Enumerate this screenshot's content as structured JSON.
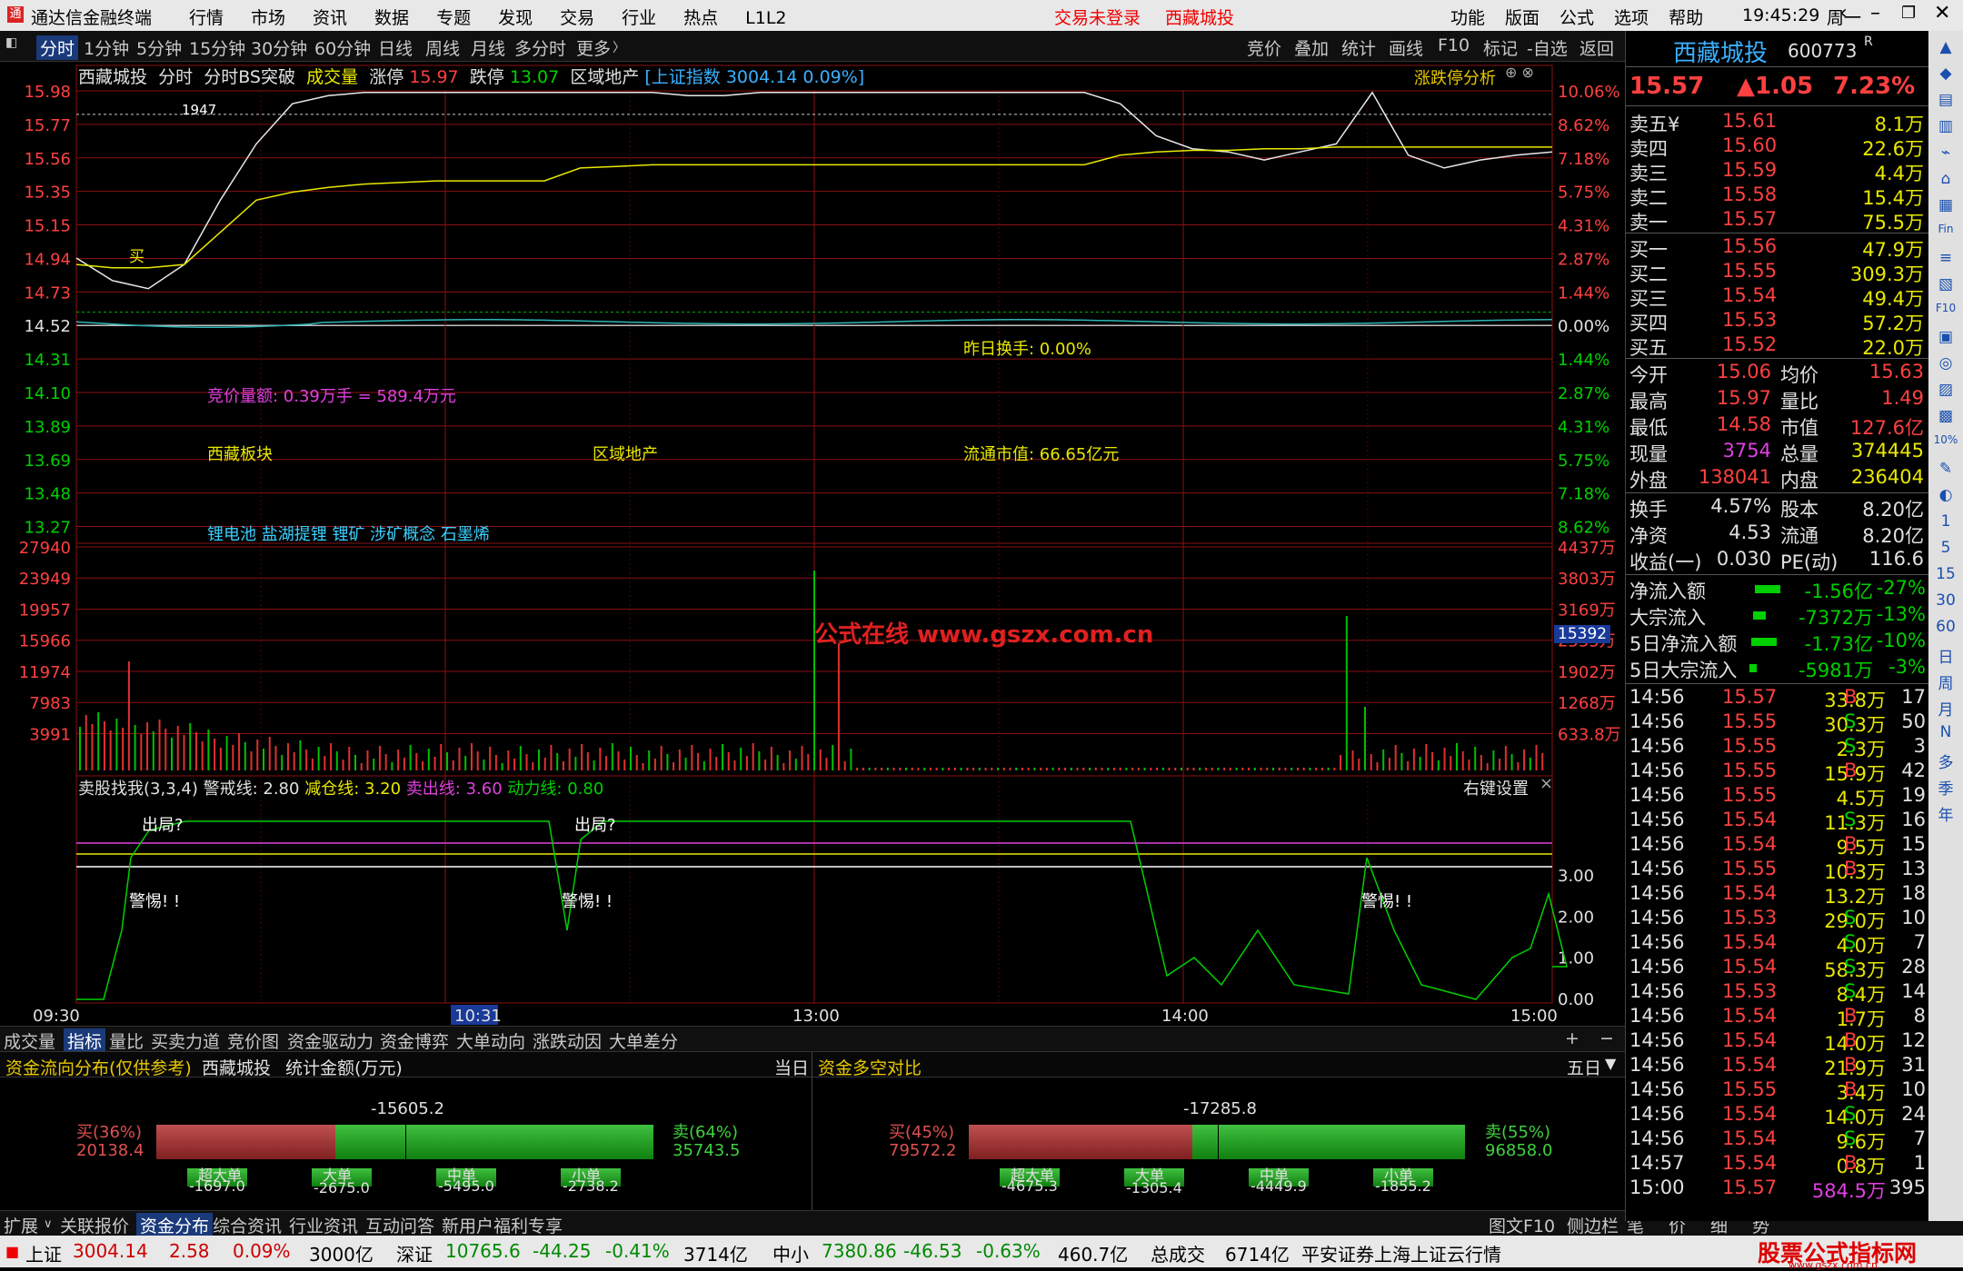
{
  "app": {
    "title": "通达信金融终端",
    "menu": [
      "行情",
      "市场",
      "资讯",
      "数据",
      "专题",
      "发现",
      "交易",
      "行业",
      "热点",
      "L1L2"
    ],
    "login_status": "交易未登录",
    "current_stock": "西藏城投",
    "right_menu": [
      "功能",
      "版面",
      "公式",
      "选项",
      "帮助"
    ],
    "clock": "19:45:29",
    "weekday": "周一"
  },
  "toolbar": {
    "periods": [
      "分时",
      "1分钟",
      "5分钟",
      "15分钟",
      "30分钟",
      "60分钟",
      "日线",
      "周线",
      "月线",
      "多分时",
      "更多"
    ],
    "right_buttons": [
      "竞价",
      "叠加",
      "统计",
      "画线",
      "F10",
      "标记",
      "-自选",
      "返回"
    ]
  },
  "chart_header": {
    "stock": "西藏城投",
    "mode": "分时",
    "formula": "分时BS突破",
    "vol_label": "成交量",
    "limit_up_label": "涨停",
    "limit_up": "15.97",
    "limit_down_label": "跌停",
    "limit_down": "13.07",
    "sector": "区域地产",
    "index_info": "[上证指数 3004.14 0.09%]",
    "analysis_btn": "涨跌停分析"
  },
  "price_axis": {
    "left": [
      "15.98",
      "15.77",
      "15.56",
      "15.35",
      "15.15",
      "14.94",
      "14.73",
      "14.52",
      "14.31",
      "14.10",
      "13.89",
      "13.69",
      "13.48",
      "13.27"
    ],
    "right": [
      "10.06%",
      "8.62%",
      "7.18%",
      "5.75%",
      "4.31%",
      "2.87%",
      "1.44%",
      "0.00%",
      "1.44%",
      "2.87%",
      "4.31%",
      "5.75%",
      "7.18%",
      "8.62%"
    ],
    "prev_close": "14.52"
  },
  "chart_data": {
    "type": "line",
    "x_ticks": [
      "09:30",
      "10:31",
      "13:00",
      "14:00",
      "15:00"
    ],
    "series": [
      {
        "name": "价格",
        "values": [
          14.94,
          14.8,
          14.75,
          14.9,
          15.3,
          15.65,
          15.9,
          15.95,
          15.97,
          15.97,
          15.97,
          15.97,
          15.97,
          15.97,
          15.97,
          15.97,
          15.97,
          15.95,
          15.95,
          15.97,
          15.97,
          15.97,
          15.97,
          15.97,
          15.97,
          15.97,
          15.97,
          15.97,
          15.97,
          15.9,
          15.7,
          15.62,
          15.6,
          15.55,
          15.6,
          15.65,
          15.97,
          15.58,
          15.5,
          15.55,
          15.58,
          15.6
        ]
      },
      {
        "name": "均价",
        "values": [
          14.9,
          14.88,
          14.88,
          14.9,
          15.1,
          15.3,
          15.35,
          15.38,
          15.4,
          15.41,
          15.42,
          15.42,
          15.42,
          15.42,
          15.5,
          15.51,
          15.52,
          15.52,
          15.52,
          15.52,
          15.52,
          15.52,
          15.52,
          15.52,
          15.52,
          15.52,
          15.52,
          15.52,
          15.52,
          15.58,
          15.6,
          15.61,
          15.61,
          15.62,
          15.62,
          15.63,
          15.63,
          15.63,
          15.63,
          15.63,
          15.63,
          15.63
        ]
      }
    ]
  },
  "annotations": {
    "high_tag": "1947",
    "buy_mark": "买",
    "turnover_yday": "昨日换手: 0.00%",
    "auction_amount": "竞价量额: 0.39万手 = 589.4万元",
    "region": "西藏板块",
    "sector2": "区域地产",
    "float_cap": "流通市值: 66.65亿元",
    "concepts": "锂电池 盐湖提锂 锂矿 涉矿概念 石墨烯",
    "watermark": "公式在线  www.gszx.com.cn"
  },
  "volume_axis": {
    "left": [
      "27940",
      "23949",
      "19957",
      "15966",
      "11974",
      "7983",
      "3991"
    ],
    "right": [
      "4437万",
      "3803万",
      "3169万",
      "2535万",
      "1902万",
      "1268万",
      "633.8万"
    ],
    "current": "15392"
  },
  "indicator": {
    "name": "卖股找我(3,3,4)",
    "alert_line": "警戒线: 2.80",
    "reduce_line": "减仓线: 3.20",
    "sell_line": "卖出线: 3.60",
    "power_line": "动力线: 0.80",
    "right_btn": "右键设置",
    "close": "×",
    "axis": [
      "3.00",
      "2.00",
      "1.00",
      "0.00"
    ],
    "labels": [
      "出局?",
      "出局?",
      "警惕! !",
      "警惕! !",
      "警惕! !"
    ]
  },
  "time_axis": [
    "09:30",
    "10:31",
    "13:00",
    "14:00",
    "15:00"
  ],
  "bottom_tabs": [
    "成交量",
    "指标",
    "量比",
    "买卖力道",
    "竞价图",
    "资金驱动力",
    "资金博弈",
    "大单动向",
    "涨跌动因",
    "大单差分"
  ],
  "flow": {
    "left_title": "资金流向分布(仅供参考)",
    "left_stock": "西藏城投",
    "left_unit": "统计金额(万元)",
    "left_period": "当日",
    "left_net": "-15605.2",
    "left_buy_pct": "买(36%)",
    "left_buy": "20138.4",
    "left_sell_pct": "卖(64%)",
    "left_sell": "35743.5",
    "left_cats": [
      {
        "name": "超大单",
        "v": "-1697.0"
      },
      {
        "name": "大单",
        "v": "-2675.0"
      },
      {
        "name": "中单",
        "v": "-5495.0"
      },
      {
        "name": "小单",
        "v": "-2738.2"
      }
    ],
    "right_title": "资金多空对比",
    "right_period": "五日",
    "right_net": "-17285.8",
    "right_buy_pct": "买(45%)",
    "right_buy": "79572.2",
    "right_sell_pct": "卖(55%)",
    "right_sell": "96858.0",
    "right_cats": [
      {
        "name": "超大单",
        "v": "-4675.3"
      },
      {
        "name": "大单",
        "v": "-1305.4"
      },
      {
        "name": "中单",
        "v": "-4449.9"
      },
      {
        "name": "小单",
        "v": "-1855.2"
      }
    ]
  },
  "status_tabs": [
    "扩展",
    "关联报价",
    "资金分布",
    "综合资讯",
    "行业资讯",
    "互动问答",
    "新用户福利专享"
  ],
  "status_right": [
    "图文F10",
    "侧边栏",
    "笔",
    "价",
    "细",
    "势"
  ],
  "statusbar": {
    "sh_label": "上证",
    "sh_val": "3004.14",
    "sh_chg": "2.58",
    "sh_pct": "0.09%",
    "sh_amt": "3000亿",
    "sz_label": "深证",
    "sz_val": "10765.6",
    "sz_chg": "-44.25",
    "sz_pct": "-0.41%",
    "sz_amt": "3714亿",
    "zx_label": "中小",
    "zx_val": "7380.86",
    "zx_chg": "-46.53",
    "zx_pct": "-0.63%",
    "zx_amt": "460.7亿",
    "total_label": "总成交",
    "total": "6714亿",
    "source": "平安证券上海上证云行情",
    "logo": "股票公式指标网",
    "logo_url": "www.gszx.com.cn"
  },
  "quote": {
    "name": "西藏城投",
    "code": "600773",
    "flag": "R",
    "price": "15.57",
    "change": "▲1.05",
    "pct": "7.23%",
    "asks": [
      {
        "l": "卖五",
        "f": "¥",
        "p": "15.61",
        "v": "8.1万"
      },
      {
        "l": "卖四",
        "p": "15.60",
        "v": "22.6万"
      },
      {
        "l": "卖三",
        "p": "15.59",
        "v": "4.4万"
      },
      {
        "l": "卖二",
        "p": "15.58",
        "v": "15.4万"
      },
      {
        "l": "卖一",
        "p": "15.57",
        "v": "75.5万"
      }
    ],
    "bids": [
      {
        "l": "买一",
        "p": "15.56",
        "v": "47.9万"
      },
      {
        "l": "买二",
        "p": "15.55",
        "v": "309.3万"
      },
      {
        "l": "买三",
        "p": "15.54",
        "v": "49.4万"
      },
      {
        "l": "买四",
        "p": "15.53",
        "v": "57.2万"
      },
      {
        "l": "买五",
        "p": "15.52",
        "v": "22.0万"
      }
    ],
    "stats": [
      [
        "今开",
        "15.06",
        "均价",
        "15.63"
      ],
      [
        "最高",
        "15.97",
        "量比",
        "1.49"
      ],
      [
        "最低",
        "14.58",
        "市值",
        "127.6亿"
      ],
      [
        "现量",
        "3754",
        "总量",
        "374445"
      ],
      [
        "外盘",
        "138041",
        "内盘",
        "236404"
      ]
    ],
    "stats2": [
      [
        "换手",
        "4.57%",
        "股本",
        "8.20亿"
      ],
      [
        "净资",
        "4.53",
        "流通",
        "8.20亿"
      ],
      [
        "收益(一)",
        "0.030",
        "PE(动)",
        "116.6"
      ]
    ],
    "flows": [
      [
        "净流入额",
        "-1.56亿",
        "-27%"
      ],
      [
        "大宗流入",
        "-7372万",
        "-13%"
      ],
      [
        "5日净流入额",
        "-1.73亿",
        "-10%"
      ],
      [
        "5日大宗流入",
        "-5981万",
        "-3%"
      ]
    ],
    "ticks": [
      [
        "14:56",
        "15.57",
        "33.8万",
        "B",
        "17"
      ],
      [
        "14:56",
        "15.55",
        "30.3万",
        "S",
        "50"
      ],
      [
        "14:56",
        "15.55",
        "2.3万",
        "S",
        "3"
      ],
      [
        "14:56",
        "15.55",
        "15.9万",
        "B",
        "42"
      ],
      [
        "14:56",
        "15.55",
        "4.5万",
        "",
        "19"
      ],
      [
        "14:56",
        "15.54",
        "11.3万",
        "S",
        "16"
      ],
      [
        "14:56",
        "15.54",
        "9.5万",
        "B",
        "15"
      ],
      [
        "14:56",
        "15.55",
        "10.3万",
        "B",
        "13"
      ],
      [
        "14:56",
        "15.54",
        "13.2万",
        "",
        "18"
      ],
      [
        "14:56",
        "15.53",
        "29.0万",
        "S",
        "10"
      ],
      [
        "14:56",
        "15.54",
        "4.0万",
        "S",
        "7"
      ],
      [
        "14:56",
        "15.54",
        "58.3万",
        "S",
        "28"
      ],
      [
        "14:56",
        "15.53",
        "8.4万",
        "S",
        "14"
      ],
      [
        "14:56",
        "15.54",
        "1.7万",
        "B",
        "8"
      ],
      [
        "14:56",
        "15.54",
        "14.0万",
        "B",
        "12"
      ],
      [
        "14:56",
        "15.54",
        "21.9万",
        "B",
        "31"
      ],
      [
        "14:56",
        "15.55",
        "3.4万",
        "B",
        "10"
      ],
      [
        "14:56",
        "15.54",
        "14.0万",
        "S",
        "24"
      ],
      [
        "14:56",
        "15.54",
        "9.6万",
        "S",
        "7"
      ],
      [
        "14:57",
        "15.54",
        "0.8万",
        "B",
        "1"
      ],
      [
        "15:00",
        "15.57",
        "584.5万",
        "",
        "395"
      ]
    ]
  },
  "side_icons": [
    "▲",
    "◆",
    "▤",
    "▥",
    "⌁",
    "⌂",
    "▦",
    "Fin",
    "≡",
    "▧",
    "F10",
    "▣",
    "◎",
    "▨",
    "▩",
    "10%",
    "✎",
    "◐",
    "1",
    "5",
    "15",
    "30",
    "60",
    "日",
    "周",
    "月",
    "N",
    "多",
    "季",
    "年"
  ]
}
